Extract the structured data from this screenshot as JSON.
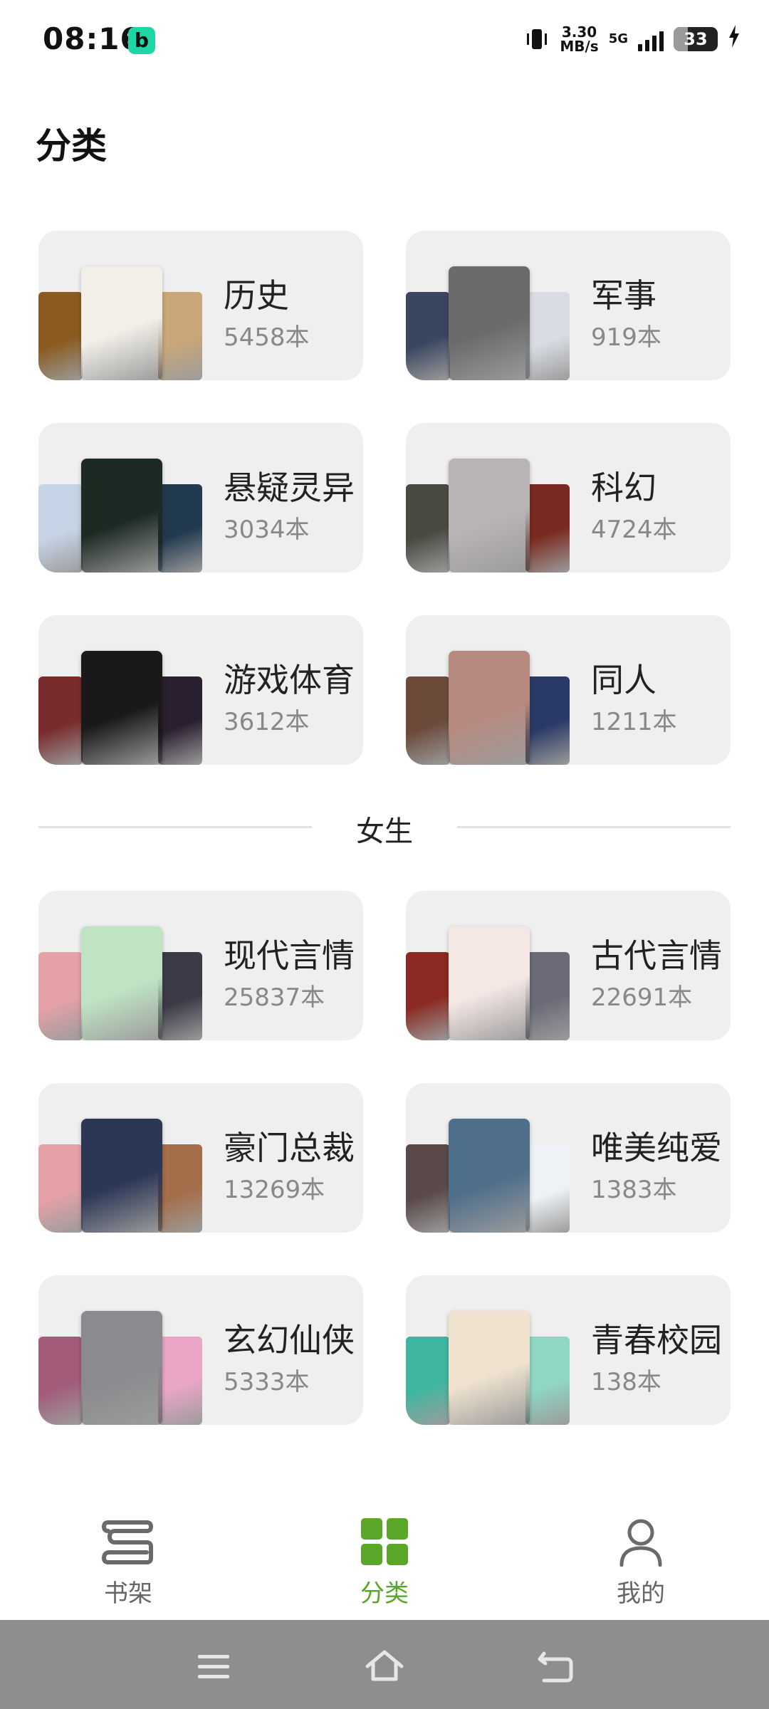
{
  "status": {
    "time": "08:16",
    "app_icon_letter": "b",
    "net_speed": "3.30",
    "net_speed_unit": "MB/s",
    "network": "5G",
    "battery": "33",
    "battery_level": 0.33
  },
  "page_title": "分类",
  "male_categories": [
    {
      "name": "历史",
      "count": "5458本",
      "covers": [
        "#8a5a1e",
        "#f2efe8",
        "#c9a77a"
      ]
    },
    {
      "name": "军事",
      "count": "919本",
      "covers": [
        "#3a4660",
        "#6b6b6b",
        "#d9dde3"
      ]
    },
    {
      "name": "悬疑灵异",
      "count": "3034本",
      "covers": [
        "#c7d3e6",
        "#1d2a24",
        "#223a4f"
      ]
    },
    {
      "name": "科幻",
      "count": "4724本",
      "covers": [
        "#4a4a42",
        "#b9b3b6",
        "#7a2a20"
      ]
    },
    {
      "name": "游戏体育",
      "count": "3612本",
      "covers": [
        "#7a2b2b",
        "#191919",
        "#2a1f30"
      ]
    },
    {
      "name": "同人",
      "count": "1211本",
      "covers": [
        "#6b4a3a",
        "#b68a7e",
        "#2a3a66"
      ]
    }
  ],
  "section_female_label": "女生",
  "female_categories": [
    {
      "name": "现代言情",
      "count": "25837本",
      "covers": [
        "#e6a1a8",
        "#bfe3c3",
        "#3c3a46"
      ]
    },
    {
      "name": "古代言情",
      "count": "22691本",
      "covers": [
        "#8a2a22",
        "#f4e7e4",
        "#6b6b78"
      ]
    },
    {
      "name": "豪门总裁",
      "count": "13269本",
      "covers": [
        "#e6a1a8",
        "#2c3756",
        "#a56e4a"
      ]
    },
    {
      "name": "唯美纯爱",
      "count": "1383本",
      "covers": [
        "#5a4a4a",
        "#4e6e8a",
        "#eef2f6"
      ]
    },
    {
      "name": "玄幻仙侠",
      "count": "5333本",
      "covers": [
        "#a35b7a",
        "#8b8b8f",
        "#e9a6c7"
      ]
    },
    {
      "name": "青春校园",
      "count": "138本",
      "covers": [
        "#3fb7a0",
        "#efe3cf",
        "#8fd6c3"
      ]
    }
  ],
  "nav": {
    "items": [
      {
        "label": "书架",
        "icon": "bookshelf-icon"
      },
      {
        "label": "分类",
        "icon": "category-grid-icon"
      },
      {
        "label": "我的",
        "icon": "person-icon"
      }
    ],
    "active_color": "#5aa628",
    "inactive_color": "#666666"
  },
  "system_nav": {
    "buttons": [
      "menu-icon",
      "home-icon",
      "back-icon"
    ]
  }
}
